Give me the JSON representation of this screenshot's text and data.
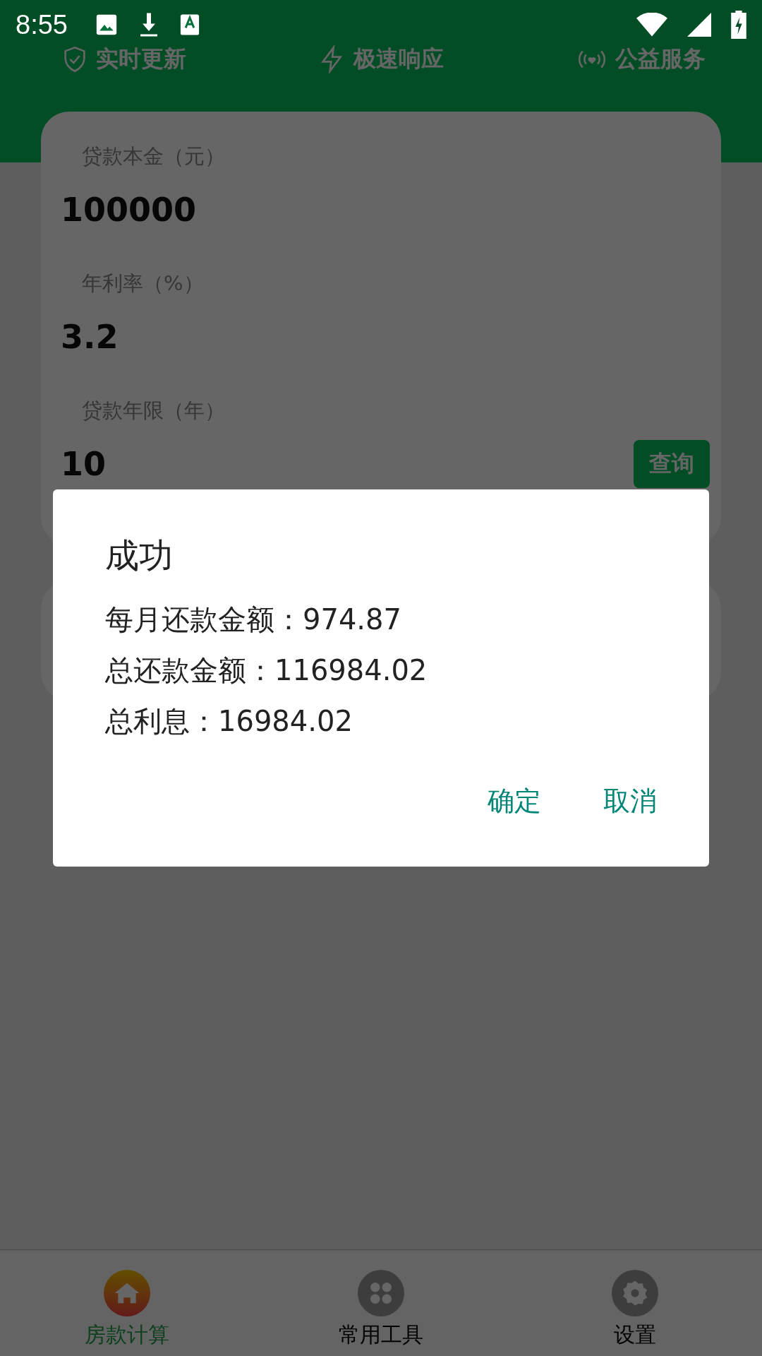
{
  "status_bar": {
    "time": "8:55"
  },
  "features": [
    {
      "kind": "shield",
      "label": "实时更新"
    },
    {
      "kind": "bolt",
      "label": "极速响应"
    },
    {
      "kind": "signal",
      "label": "公益服务"
    }
  ],
  "form": {
    "fields": [
      {
        "label": "贷款本金（元）",
        "value": "100000"
      },
      {
        "label": "年利率（%）",
        "value": "3.2"
      },
      {
        "label": "贷款年限（年）",
        "value": "10"
      }
    ],
    "query_button": "查询"
  },
  "dialog": {
    "title": "成功",
    "lines": [
      "每月还款金额：974.87",
      "总还款金额：116984.02",
      "总利息：16984.02"
    ],
    "buttons": [
      "确定",
      "取消"
    ]
  },
  "bottom_nav": [
    {
      "kind": "home",
      "label": "房款计算",
      "selected": true
    },
    {
      "kind": "clover",
      "label": "常用工具",
      "selected": false
    },
    {
      "kind": "gear",
      "label": "设置",
      "selected": false
    }
  ]
}
